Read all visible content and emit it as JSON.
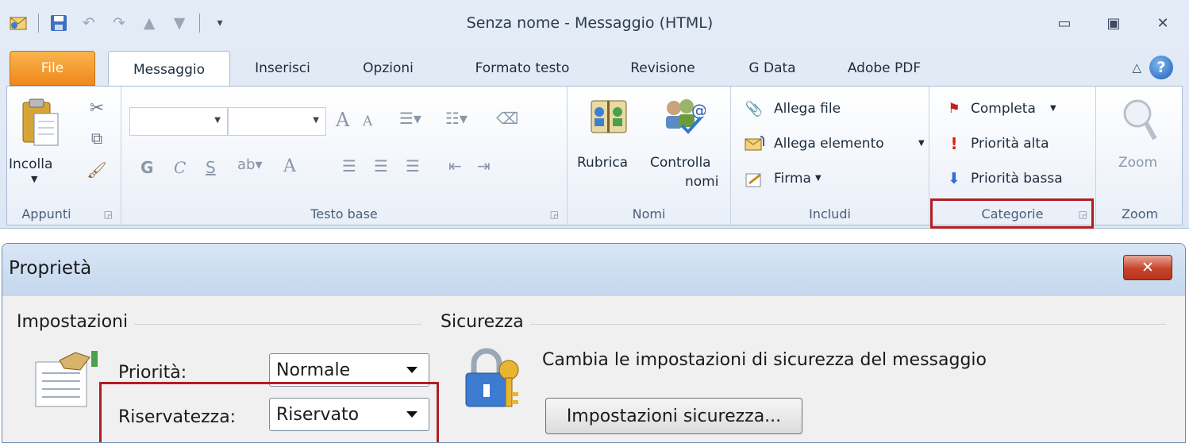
{
  "window": {
    "title": "Senza nome - Messaggio (HTML)"
  },
  "tabs": {
    "file": "File",
    "messaggio": "Messaggio",
    "inserisci": "Inserisci",
    "opzioni": "Opzioni",
    "formato_testo": "Formato testo",
    "revisione": "Revisione",
    "gdata": "G Data",
    "adobe_pdf": "Adobe PDF",
    "help": "?"
  },
  "ribbon": {
    "appunti": {
      "label": "Appunti",
      "paste": "Incolla"
    },
    "testo_base": {
      "label": "Testo base",
      "bold": "G",
      "italic": "C",
      "underline": "S",
      "grow_font": "A",
      "shrink_font": "A",
      "font_color": "A"
    },
    "nomi": {
      "label": "Nomi",
      "rubrica": "Rubrica",
      "controlla_line1": "Controlla",
      "controlla_line2": "nomi"
    },
    "includi": {
      "label": "Includi",
      "allega_file": "Allega file",
      "allega_elemento": "Allega elemento",
      "firma": "Firma"
    },
    "categorie": {
      "label": "Categorie",
      "completa": "Completa",
      "priorita_alta": "Priorità alta",
      "priorita_bassa": "Priorità bassa"
    },
    "zoom": {
      "label": "Zoom",
      "button": "Zoom"
    }
  },
  "dialog": {
    "title": "Proprietà",
    "close_glyph": "✕",
    "impostazioni": {
      "heading": "Impostazioni",
      "priorita_label": "Priorità:",
      "priorita_value": "Normale",
      "riservatezza_label": "Riservatezza:",
      "riservatezza_value": "Riservato"
    },
    "sicurezza": {
      "heading": "Sicurezza",
      "description": "Cambia le impostazioni di sicurezza del messaggio",
      "button": "Impostazioni sicurezza..."
    }
  },
  "colors": {
    "highlight": "#b11d24",
    "file_tab": "#f0871b",
    "close_button": "#c7432b"
  }
}
